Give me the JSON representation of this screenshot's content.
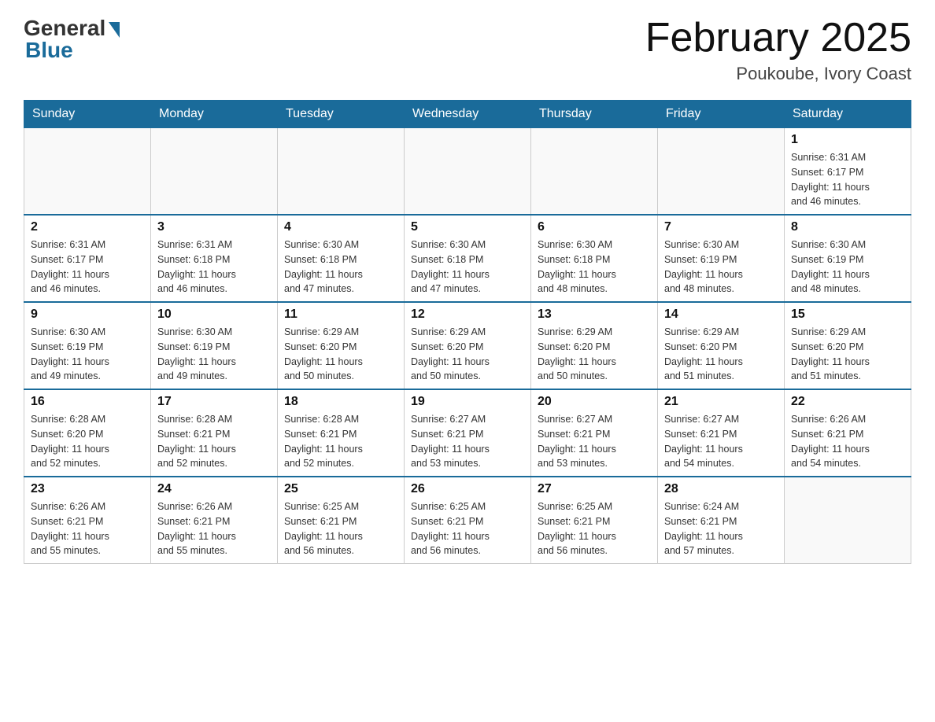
{
  "header": {
    "logo_general": "General",
    "logo_blue": "Blue",
    "month_title": "February 2025",
    "location": "Poukoube, Ivory Coast"
  },
  "weekdays": [
    "Sunday",
    "Monday",
    "Tuesday",
    "Wednesday",
    "Thursday",
    "Friday",
    "Saturday"
  ],
  "weeks": [
    [
      {
        "day": "",
        "info": ""
      },
      {
        "day": "",
        "info": ""
      },
      {
        "day": "",
        "info": ""
      },
      {
        "day": "",
        "info": ""
      },
      {
        "day": "",
        "info": ""
      },
      {
        "day": "",
        "info": ""
      },
      {
        "day": "1",
        "info": "Sunrise: 6:31 AM\nSunset: 6:17 PM\nDaylight: 11 hours\nand 46 minutes."
      }
    ],
    [
      {
        "day": "2",
        "info": "Sunrise: 6:31 AM\nSunset: 6:17 PM\nDaylight: 11 hours\nand 46 minutes."
      },
      {
        "day": "3",
        "info": "Sunrise: 6:31 AM\nSunset: 6:18 PM\nDaylight: 11 hours\nand 46 minutes."
      },
      {
        "day": "4",
        "info": "Sunrise: 6:30 AM\nSunset: 6:18 PM\nDaylight: 11 hours\nand 47 minutes."
      },
      {
        "day": "5",
        "info": "Sunrise: 6:30 AM\nSunset: 6:18 PM\nDaylight: 11 hours\nand 47 minutes."
      },
      {
        "day": "6",
        "info": "Sunrise: 6:30 AM\nSunset: 6:18 PM\nDaylight: 11 hours\nand 48 minutes."
      },
      {
        "day": "7",
        "info": "Sunrise: 6:30 AM\nSunset: 6:19 PM\nDaylight: 11 hours\nand 48 minutes."
      },
      {
        "day": "8",
        "info": "Sunrise: 6:30 AM\nSunset: 6:19 PM\nDaylight: 11 hours\nand 48 minutes."
      }
    ],
    [
      {
        "day": "9",
        "info": "Sunrise: 6:30 AM\nSunset: 6:19 PM\nDaylight: 11 hours\nand 49 minutes."
      },
      {
        "day": "10",
        "info": "Sunrise: 6:30 AM\nSunset: 6:19 PM\nDaylight: 11 hours\nand 49 minutes."
      },
      {
        "day": "11",
        "info": "Sunrise: 6:29 AM\nSunset: 6:20 PM\nDaylight: 11 hours\nand 50 minutes."
      },
      {
        "day": "12",
        "info": "Sunrise: 6:29 AM\nSunset: 6:20 PM\nDaylight: 11 hours\nand 50 minutes."
      },
      {
        "day": "13",
        "info": "Sunrise: 6:29 AM\nSunset: 6:20 PM\nDaylight: 11 hours\nand 50 minutes."
      },
      {
        "day": "14",
        "info": "Sunrise: 6:29 AM\nSunset: 6:20 PM\nDaylight: 11 hours\nand 51 minutes."
      },
      {
        "day": "15",
        "info": "Sunrise: 6:29 AM\nSunset: 6:20 PM\nDaylight: 11 hours\nand 51 minutes."
      }
    ],
    [
      {
        "day": "16",
        "info": "Sunrise: 6:28 AM\nSunset: 6:20 PM\nDaylight: 11 hours\nand 52 minutes."
      },
      {
        "day": "17",
        "info": "Sunrise: 6:28 AM\nSunset: 6:21 PM\nDaylight: 11 hours\nand 52 minutes."
      },
      {
        "day": "18",
        "info": "Sunrise: 6:28 AM\nSunset: 6:21 PM\nDaylight: 11 hours\nand 52 minutes."
      },
      {
        "day": "19",
        "info": "Sunrise: 6:27 AM\nSunset: 6:21 PM\nDaylight: 11 hours\nand 53 minutes."
      },
      {
        "day": "20",
        "info": "Sunrise: 6:27 AM\nSunset: 6:21 PM\nDaylight: 11 hours\nand 53 minutes."
      },
      {
        "day": "21",
        "info": "Sunrise: 6:27 AM\nSunset: 6:21 PM\nDaylight: 11 hours\nand 54 minutes."
      },
      {
        "day": "22",
        "info": "Sunrise: 6:26 AM\nSunset: 6:21 PM\nDaylight: 11 hours\nand 54 minutes."
      }
    ],
    [
      {
        "day": "23",
        "info": "Sunrise: 6:26 AM\nSunset: 6:21 PM\nDaylight: 11 hours\nand 55 minutes."
      },
      {
        "day": "24",
        "info": "Sunrise: 6:26 AM\nSunset: 6:21 PM\nDaylight: 11 hours\nand 55 minutes."
      },
      {
        "day": "25",
        "info": "Sunrise: 6:25 AM\nSunset: 6:21 PM\nDaylight: 11 hours\nand 56 minutes."
      },
      {
        "day": "26",
        "info": "Sunrise: 6:25 AM\nSunset: 6:21 PM\nDaylight: 11 hours\nand 56 minutes."
      },
      {
        "day": "27",
        "info": "Sunrise: 6:25 AM\nSunset: 6:21 PM\nDaylight: 11 hours\nand 56 minutes."
      },
      {
        "day": "28",
        "info": "Sunrise: 6:24 AM\nSunset: 6:21 PM\nDaylight: 11 hours\nand 57 minutes."
      },
      {
        "day": "",
        "info": ""
      }
    ]
  ]
}
